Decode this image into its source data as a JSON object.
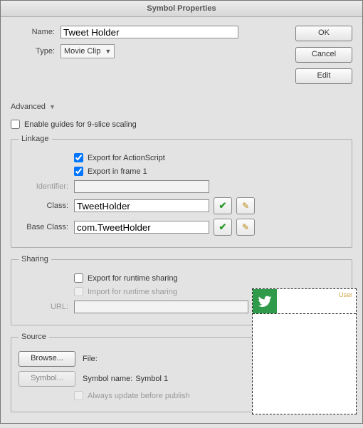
{
  "dialog": {
    "title": "Symbol Properties"
  },
  "buttons": {
    "ok": "OK",
    "cancel": "Cancel",
    "edit": "Edit"
  },
  "form": {
    "name_label": "Name:",
    "name_value": "Tweet Holder",
    "type_label": "Type:",
    "type_value": "Movie Clip"
  },
  "advanced": {
    "label": "Advanced"
  },
  "nine_slice": {
    "label": "Enable guides for 9-slice scaling",
    "checked": false
  },
  "linkage": {
    "legend": "Linkage",
    "export_as": {
      "label": "Export for ActionScript",
      "checked": true
    },
    "export_f1": {
      "label": "Export in frame 1",
      "checked": true
    },
    "identifier_label": "Identifier:",
    "identifier_value": "",
    "class_label": "Class:",
    "class_value": "TweetHolder",
    "base_label": "Base Class:",
    "base_value": "com.TweetHolder"
  },
  "sharing": {
    "legend": "Sharing",
    "export_runtime": {
      "label": "Export for runtime sharing",
      "checked": false
    },
    "import_runtime": {
      "label": "Import for runtime sharing",
      "checked": false
    },
    "url_label": "URL:",
    "url_value": ""
  },
  "source": {
    "legend": "Source",
    "browse": "Browse...",
    "file_label": "File:",
    "file_value": "",
    "symbol_btn": "Symbol...",
    "symbol_label": "Symbol name:",
    "symbol_value": "Symbol 1",
    "always_update": {
      "label": "Always update before publish",
      "checked": false
    }
  },
  "preview": {
    "user_label": "User"
  }
}
